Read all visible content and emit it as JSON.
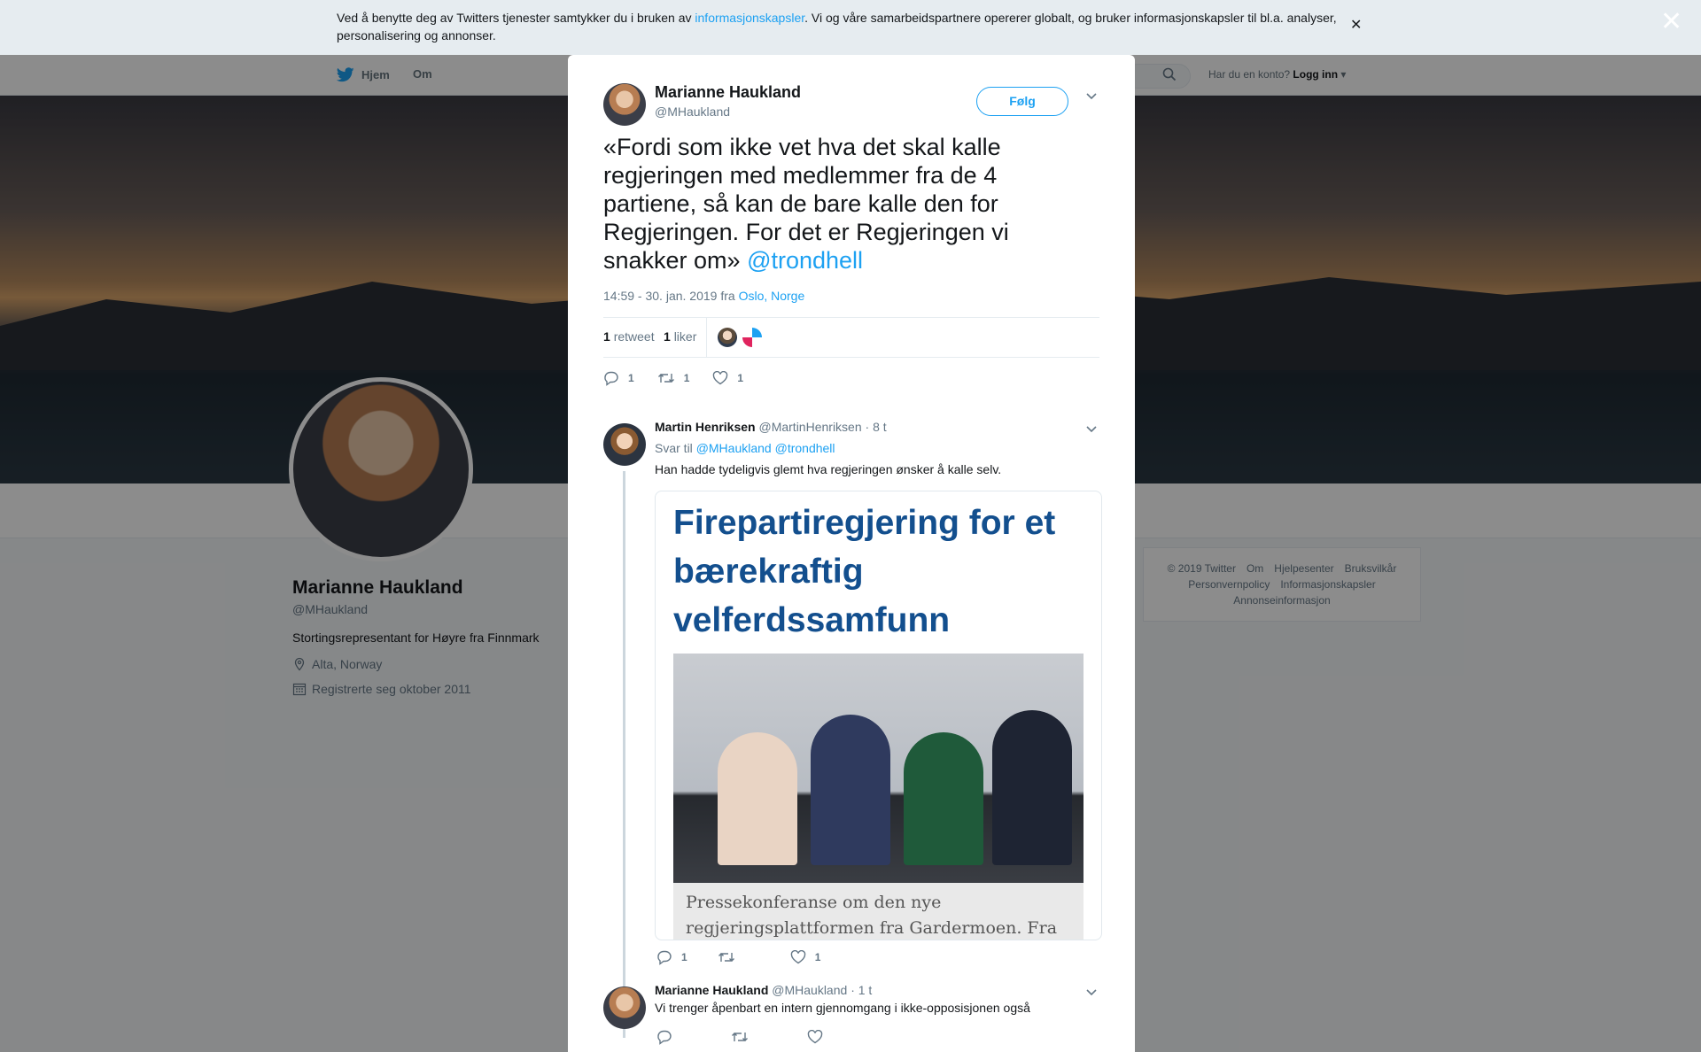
{
  "cookie": {
    "text_before": "Ved å benytte deg av Twitters tjenester samtykker du i bruken av ",
    "link": "informasjonskapsler",
    "text_after": ". Vi og våre samarbeidspartnere opererer globalt, og bruker informasjonskapsler til bl.a. analyser, personalisering og annonser."
  },
  "nav": {
    "home": "Hjem",
    "about": "Om",
    "login_prompt": "Har du en konto?",
    "login": "Logg inn"
  },
  "profile": {
    "name": "Marianne Haukland",
    "handle": "@MHaukland",
    "bio": "Stortingsrepresentant for Høyre fra Finnmark",
    "location": "Alta, Norway",
    "joined": "Registrerte seg oktober 2011"
  },
  "footer": {
    "links": [
      "© 2019 Twitter",
      "Om",
      "Hjelpesenter",
      "Bruksvilkår",
      "Personvernpolicy",
      "Informasjonskapsler",
      "Annonseinformasjon"
    ]
  },
  "tweet": {
    "name": "Marianne Haukland",
    "handle": "@MHaukland",
    "follow": "Følg",
    "text": "«Fordi som ikke vet hva det skal kalle regjeringen med medlemmer fra de 4 partiene, så kan de bare kalle den for Regjeringen. For det er Regjeringen vi snakker om» ",
    "mention": "@trondhell",
    "time": "14:59 - 30. jan. 2019 fra ",
    "place": "Oslo, Norge",
    "retweets_count": "1",
    "retweets_label": "retweet",
    "likes_count": "1",
    "likes_label": "liker",
    "actions": {
      "replies": "1",
      "retweets": "1",
      "likes": "1"
    }
  },
  "replies": [
    {
      "name": "Martin Henriksen",
      "handle": "@MartinHenriksen",
      "time": "· 8 t",
      "reply_to_label": "Svar til",
      "reply_to": "@MHaukland @trondhell",
      "text": "Han hadde tydeligvis glemt hva regjeringen ønsker å kalle selv.",
      "card_title": "Firepartiregjering for et bærekraftig velferdssamfunn",
      "card_caption": "Pressekonferanse om den nye regjeringsplattformen fra Gardermoen. Fra",
      "actions": {
        "replies": "1",
        "retweets": "",
        "likes": "1"
      }
    },
    {
      "name": "Marianne Haukland",
      "handle": "@MHaukland",
      "time": "· 1 t",
      "text": "Vi trenger åpenbart en intern gjennomgang i ikke-opposisjonen også"
    }
  ],
  "icons": [
    "twitter-bird-icon",
    "search-icon",
    "location-icon",
    "calendar-icon",
    "close-icon",
    "chevron-down-icon",
    "reply-icon",
    "retweet-icon",
    "like-icon"
  ],
  "colors": {
    "accent": "#1da1f2",
    "text": "#14171a",
    "muted": "#657786",
    "card_title": "#134f8e"
  }
}
